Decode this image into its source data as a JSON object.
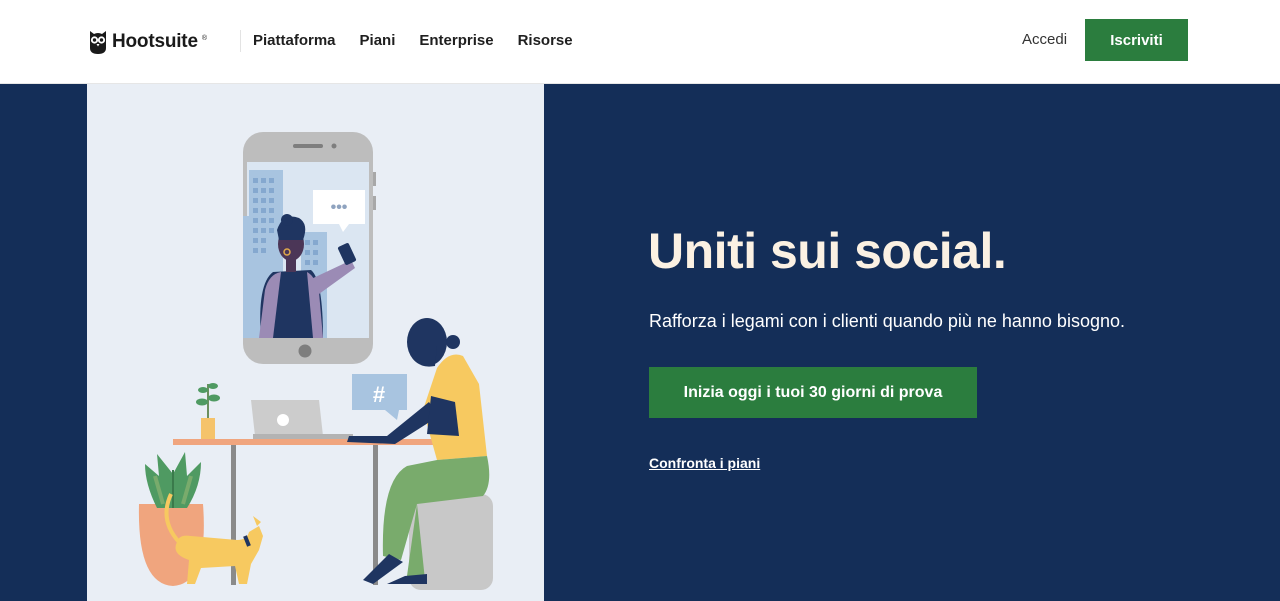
{
  "header": {
    "logo_text": "Hootsuite",
    "logo_mark": "®",
    "nav": [
      {
        "label": "Piattaforma"
      },
      {
        "label": "Piani"
      },
      {
        "label": "Enterprise"
      },
      {
        "label": "Risorse"
      }
    ],
    "login_label": "Accedi",
    "signup_label": "Iscriviti"
  },
  "hero": {
    "headline": "Uniti sui social.",
    "subtext": "Rafforza i legami con i clienti quando più ne hanno bisogno.",
    "cta_label": "Inizia oggi i tuoi 30 giorni di prova",
    "compare_label": "Confronta i piani",
    "illustration": {
      "chat_bubble_text": "•••",
      "hashtag_text": "#"
    }
  },
  "colors": {
    "navy": "#142e58",
    "green": "#2b7d3e",
    "cream": "#fbf1e3",
    "illustration_bg": "#e9eef5"
  },
  "icons": [
    "owl-logo-icon"
  ]
}
